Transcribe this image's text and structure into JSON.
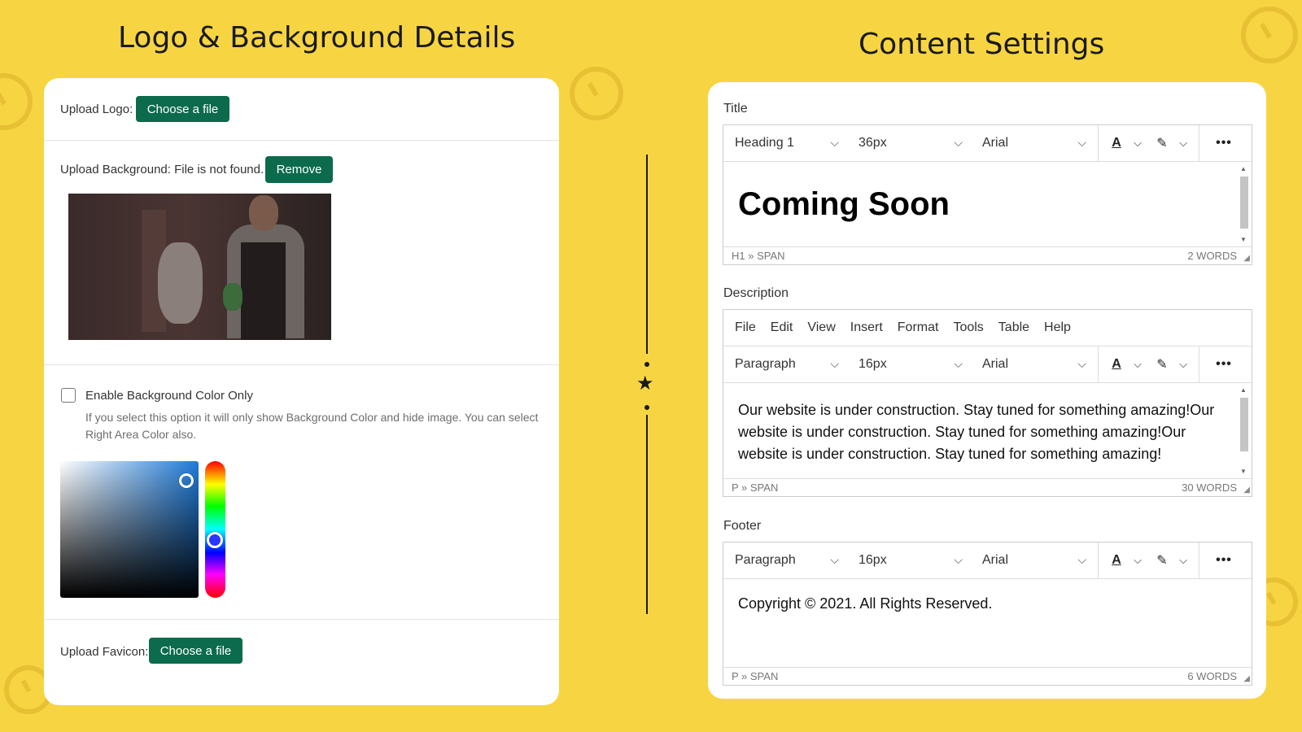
{
  "left_heading": "Logo & Background Details",
  "right_heading": "Content Settings",
  "left_panel": {
    "upload_logo_label": "Upload Logo:",
    "upload_logo_button": "Choose a file",
    "upload_background_label": "Upload Background: File is not found.",
    "remove_button": "Remove",
    "enable_bg_color_label": "Enable Background Color Only",
    "enable_bg_color_checked": false,
    "enable_bg_color_help": "If you select this option it will only show Background Color and hide image. You can select Right Area Color also.",
    "upload_favicon_label": "Upload Favicon:",
    "upload_favicon_button": "Choose a file",
    "picker_color": "#1f7ad8",
    "accent_color": "#0b6b4c"
  },
  "right_panel": {
    "title_section": {
      "label": "Title",
      "block_format": "Heading 1",
      "font_size": "36px",
      "font_family": "Arial",
      "content": "Coming Soon",
      "path": "H1 » SPAN",
      "word_count": "2 WORDS"
    },
    "description_section": {
      "label": "Description",
      "menu": [
        "File",
        "Edit",
        "View",
        "Insert",
        "Format",
        "Tools",
        "Table",
        "Help"
      ],
      "block_format": "Paragraph",
      "font_size": "16px",
      "font_family": "Arial",
      "content": "Our website is under construction. Stay tuned for something amazing!Our website is under construction. Stay tuned for something amazing!Our website is under construction. Stay tuned for something amazing!",
      "path": "P » SPAN",
      "word_count": "30 WORDS"
    },
    "footer_section": {
      "label": "Footer",
      "block_format": "Paragraph",
      "font_size": "16px",
      "font_family": "Arial",
      "content": "Copyright © 2021. All Rights Reserved.",
      "path": "P » SPAN",
      "word_count": "6 WORDS"
    },
    "icons": {
      "text_color": "text-color-icon",
      "highlight": "highlight-pen-icon",
      "more": "more-dots-icon",
      "chevron": "chevron-down-icon"
    }
  }
}
